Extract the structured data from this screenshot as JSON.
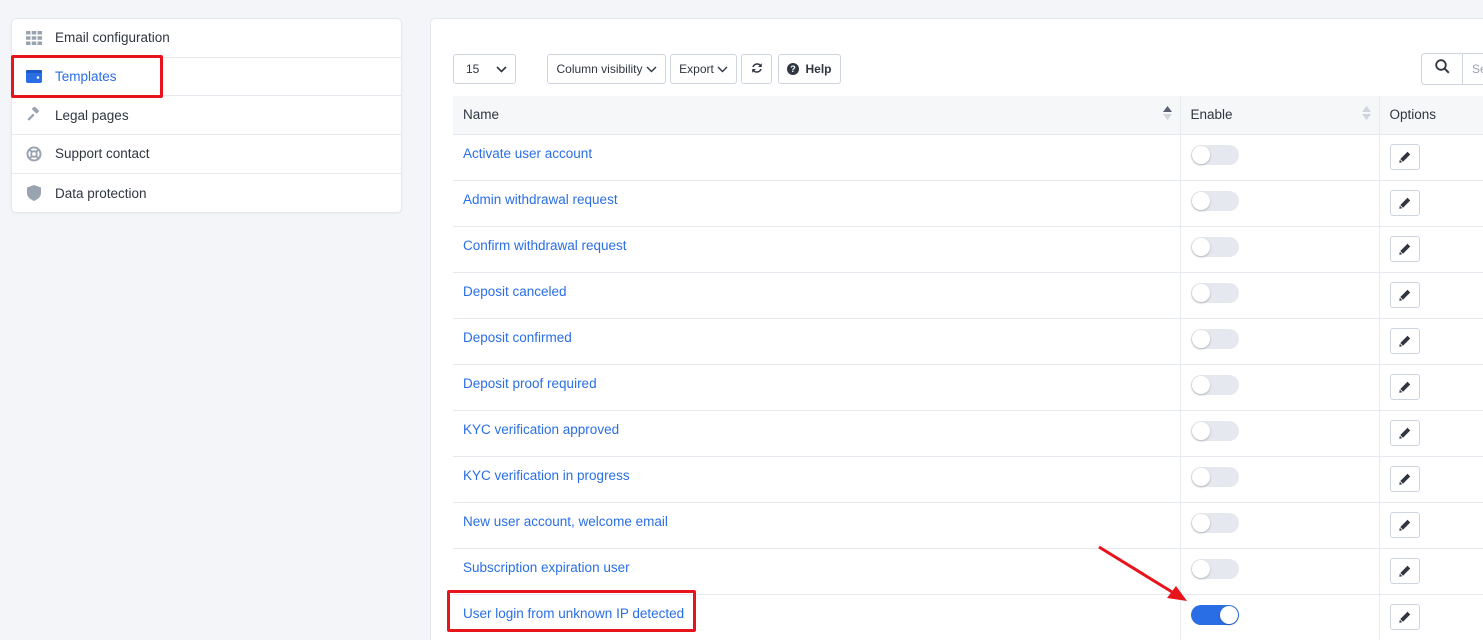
{
  "sidebar": {
    "items": [
      {
        "label": "Email configuration",
        "icon": "grid-icon",
        "active": false
      },
      {
        "label": "Templates",
        "icon": "wallet-icon",
        "active": true
      },
      {
        "label": "Legal pages",
        "icon": "gavel-icon",
        "active": false
      },
      {
        "label": "Support contact",
        "icon": "lifebuoy-icon",
        "active": false
      },
      {
        "label": "Data protection",
        "icon": "shield-icon",
        "active": false
      }
    ]
  },
  "toolbar": {
    "page_length": "15",
    "column_visibility_label": "Column visibility",
    "export_label": "Export",
    "help_label": "Help",
    "search_placeholder": "Se"
  },
  "table": {
    "headers": {
      "name": "Name",
      "enable": "Enable",
      "options": "Options"
    },
    "rows": [
      {
        "name": "Activate user account",
        "enabled": false
      },
      {
        "name": "Admin withdrawal request",
        "enabled": false
      },
      {
        "name": "Confirm withdrawal request",
        "enabled": false
      },
      {
        "name": "Deposit canceled",
        "enabled": false
      },
      {
        "name": "Deposit confirmed",
        "enabled": false
      },
      {
        "name": "Deposit proof required",
        "enabled": false
      },
      {
        "name": "KYC verification approved",
        "enabled": false
      },
      {
        "name": "KYC verification in progress",
        "enabled": false
      },
      {
        "name": "New user account, welcome email",
        "enabled": false
      },
      {
        "name": "Subscription expiration user",
        "enabled": false
      },
      {
        "name": "User login from unknown IP detected",
        "enabled": true
      }
    ]
  },
  "colors": {
    "accent": "#2a6ee6",
    "highlight": "#e8141c"
  }
}
